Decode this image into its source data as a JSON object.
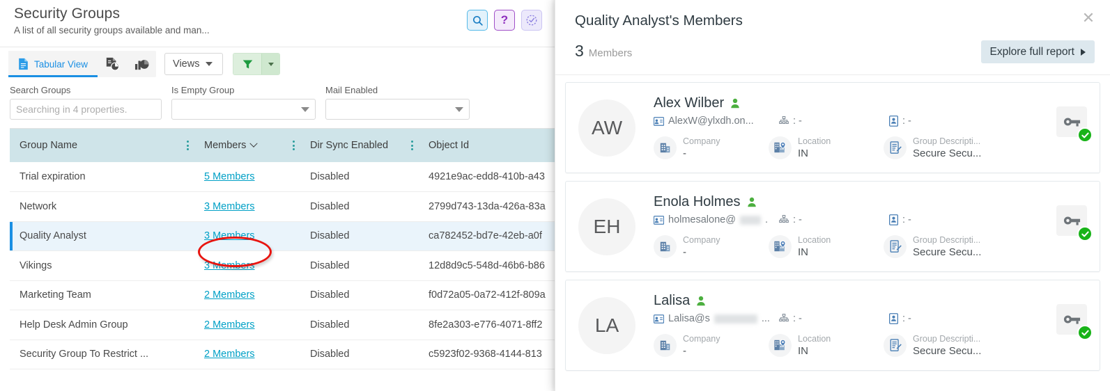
{
  "header": {
    "title": "Security Groups",
    "subtitle": "A list of all security groups available and man...",
    "actions": [
      {
        "name": "search-icon",
        "label": "Search"
      },
      {
        "name": "help-icon",
        "label": "?"
      },
      {
        "name": "history-icon",
        "label": "Recent"
      }
    ]
  },
  "toolbar": {
    "tabular_view_label": "Tabular View",
    "export_icon": "export-report-icon",
    "chart_icon": "chart-view-icon",
    "views_label": "Views",
    "filter_icon": "filter-icon"
  },
  "filters": {
    "search_groups_label": "Search Groups",
    "search_groups_placeholder": "Searching in 4 properties.",
    "search_groups_value": "",
    "is_empty_group_label": "Is Empty Group",
    "is_empty_group_value": "",
    "mail_enabled_label": "Mail Enabled",
    "mail_enabled_value": ""
  },
  "table": {
    "columns": [
      {
        "label": "Group Name",
        "sorted": false,
        "menu": true
      },
      {
        "label": "Members",
        "sorted": true,
        "menu": true
      },
      {
        "label": "Dir Sync Enabled",
        "sorted": false,
        "menu": true
      },
      {
        "label": "Object Id",
        "sorted": false,
        "menu": false
      }
    ],
    "rows": [
      {
        "group_name": "Trial expiration",
        "members": "5 Members",
        "dir_sync": "Disabled",
        "object_id": "4921e9ac-edd8-410b-a43",
        "selected": false
      },
      {
        "group_name": "Network",
        "members": "3 Members",
        "dir_sync": "Disabled",
        "object_id": "2799d743-13da-426a-83a",
        "selected": false
      },
      {
        "group_name": "Quality Analyst",
        "members": "3 Members",
        "dir_sync": "Disabled",
        "object_id": "ca782452-bd7e-42eb-a0f",
        "selected": true
      },
      {
        "group_name": "Vikings",
        "members": "3 Members",
        "dir_sync": "Disabled",
        "object_id": "12d8d9c5-548d-46b6-b86",
        "selected": false
      },
      {
        "group_name": "Marketing Team",
        "members": "2 Members",
        "dir_sync": "Disabled",
        "object_id": "f0d72a05-0a72-412f-809a",
        "selected": false
      },
      {
        "group_name": "Help Desk Admin Group",
        "members": "2 Members",
        "dir_sync": "Disabled",
        "object_id": "8fe2a303-e776-4071-8ff2",
        "selected": false
      },
      {
        "group_name": "Security Group To Restrict ...",
        "members": "2 Members",
        "dir_sync": "Disabled",
        "object_id": "c5923f02-9368-4144-813",
        "selected": false
      }
    ]
  },
  "panel": {
    "title": "Quality Analyst's Members",
    "count": "3",
    "count_label": "Members",
    "explore_label": "Explore full report",
    "close_label": "✕",
    "members": [
      {
        "initials": "AW",
        "name": "Alex Wilber",
        "email": "AlexW@ylxdh.on...",
        "email_redacted": false,
        "manager": ": -",
        "id_value": ": -",
        "company_label": "Company",
        "company_value": "-",
        "location_label": "Location",
        "location_value": "IN",
        "group_desc_label": "Group Descripti...",
        "group_desc_value": "Secure Secu..."
      },
      {
        "initials": "EH",
        "name": "Enola Holmes",
        "email": "holmesalone@",
        "email_redacted": true,
        "manager": ": -",
        "id_value": ": -",
        "company_label": "Company",
        "company_value": "-",
        "location_label": "Location",
        "location_value": "IN",
        "group_desc_label": "Group Descripti...",
        "group_desc_value": "Secure Secu..."
      },
      {
        "initials": "LA",
        "name": "Lalisa",
        "email": "Lalisa@s",
        "email_redacted": true,
        "manager": ": -",
        "id_value": ": -",
        "company_label": "Company",
        "company_value": "-",
        "location_label": "Location",
        "location_value": "IN",
        "group_desc_label": "Group Descripti...",
        "group_desc_value": "Secure Secu..."
      }
    ]
  },
  "annotation": {
    "shape": "red-ellipse",
    "color": "#e8140f",
    "target": "3 Members"
  },
  "colors": {
    "link": "#00a0c6",
    "table_header_bg": "#cfe4e9",
    "selected_row_bg": "#eaf4fb",
    "selected_row_accent": "#1a8fe3",
    "accent_blue": "#1a8fe3",
    "green": "#18b318",
    "panel_btn_bg": "#dde8ee"
  }
}
